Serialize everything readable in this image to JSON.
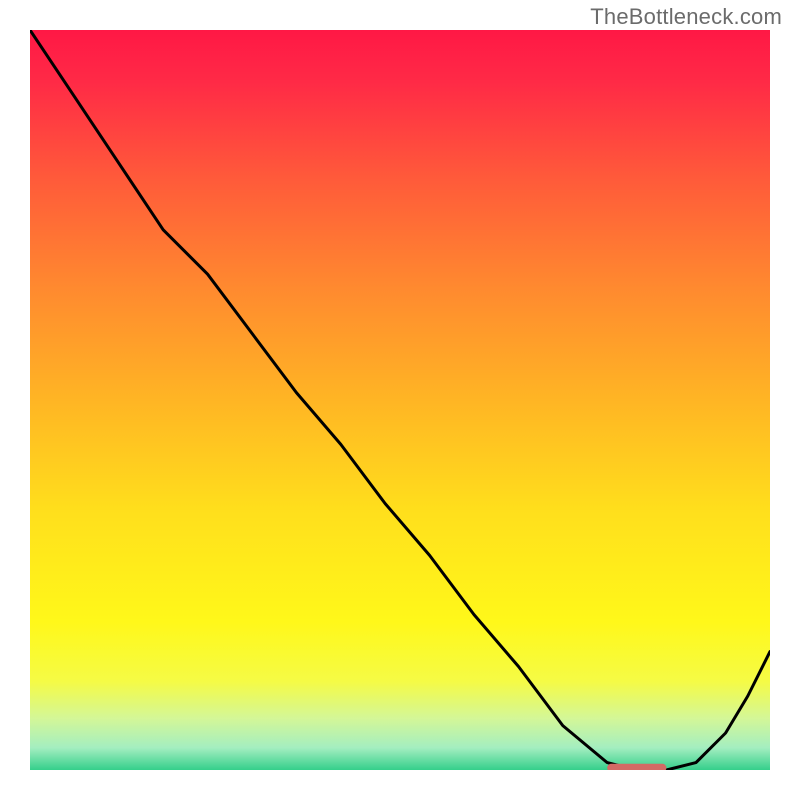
{
  "watermark": "TheBottleneck.com",
  "chart_data": {
    "type": "line",
    "x": [
      0.0,
      0.06,
      0.12,
      0.18,
      0.24,
      0.3,
      0.36,
      0.42,
      0.48,
      0.54,
      0.6,
      0.66,
      0.72,
      0.78,
      0.82,
      0.86,
      0.9,
      0.94,
      0.97,
      1.0
    ],
    "y": [
      1.0,
      0.91,
      0.82,
      0.73,
      0.67,
      0.59,
      0.51,
      0.44,
      0.36,
      0.29,
      0.21,
      0.14,
      0.06,
      0.01,
      0.0,
      0.0,
      0.01,
      0.05,
      0.1,
      0.16
    ],
    "xlim": [
      0,
      1
    ],
    "ylim": [
      0,
      1
    ],
    "plateau": {
      "x0": 0.78,
      "x1": 0.86,
      "y": 0.003
    },
    "background_gradient": {
      "stops": [
        {
          "offset": 0.0,
          "color": "#ff1845"
        },
        {
          "offset": 0.07,
          "color": "#ff2a46"
        },
        {
          "offset": 0.2,
          "color": "#ff5a3a"
        },
        {
          "offset": 0.35,
          "color": "#ff8a2f"
        },
        {
          "offset": 0.5,
          "color": "#ffb524"
        },
        {
          "offset": 0.65,
          "color": "#ffdf1c"
        },
        {
          "offset": 0.8,
          "color": "#fff81a"
        },
        {
          "offset": 0.88,
          "color": "#f5fb45"
        },
        {
          "offset": 0.93,
          "color": "#d4f797"
        },
        {
          "offset": 0.97,
          "color": "#a4eec0"
        },
        {
          "offset": 1.0,
          "color": "#35cf8b"
        }
      ]
    },
    "plateau_color": "#d36a65",
    "line_color": "#000000"
  }
}
